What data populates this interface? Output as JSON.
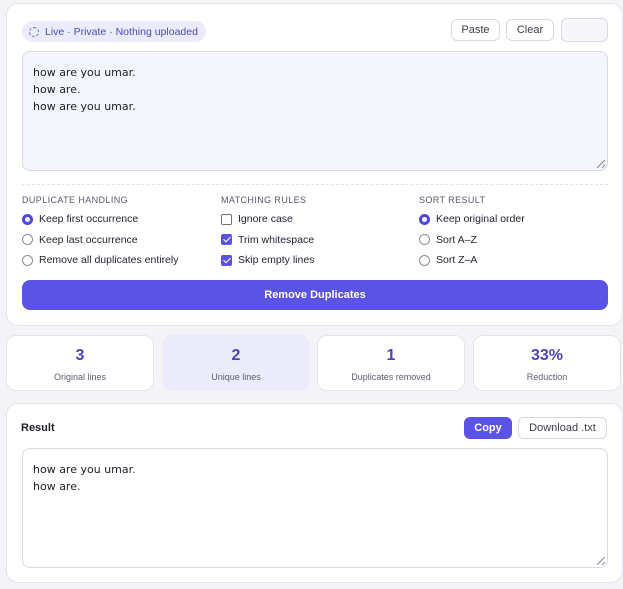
{
  "status_badge": {
    "label": "Live · Private · Nothing uploaded"
  },
  "toolbar": {
    "paste_label": "Paste",
    "clear_label": "Clear",
    "extra_label": ""
  },
  "input": {
    "value": "how are you umar.\nhow are.\nhow are you umar."
  },
  "options": {
    "duplicate_handling": {
      "heading": "DUPLICATE HANDLING",
      "items": [
        {
          "label": "Keep first occurrence",
          "selected": true
        },
        {
          "label": "Keep last occurrence",
          "selected": false
        },
        {
          "label": "Remove all duplicates entirely",
          "selected": false
        }
      ]
    },
    "matching_rules": {
      "heading": "MATCHING RULES",
      "items": [
        {
          "label": "Ignore case",
          "checked": false
        },
        {
          "label": "Trim whitespace",
          "checked": true
        },
        {
          "label": "Skip empty lines",
          "checked": true
        }
      ]
    },
    "sort_result": {
      "heading": "SORT RESULT",
      "items": [
        {
          "label": "Keep original order",
          "selected": true
        },
        {
          "label": "Sort A–Z",
          "selected": false
        },
        {
          "label": "Sort Z–A",
          "selected": false
        }
      ]
    }
  },
  "action": {
    "remove_label": "Remove Duplicates"
  },
  "stats": [
    {
      "value": "3",
      "label": "Original lines"
    },
    {
      "value": "2",
      "label": "Unique lines"
    },
    {
      "value": "1",
      "label": "Duplicates removed"
    },
    {
      "value": "33%",
      "label": "Reduction"
    }
  ],
  "result": {
    "title": "Result",
    "copy_label": "Copy",
    "download_label": "Download .txt",
    "value": "how are you umar.\nhow are."
  },
  "colors": {
    "accent": "#5b52e6",
    "accent_soft": "#ecebfb",
    "stat_value": "#4a44b8"
  }
}
